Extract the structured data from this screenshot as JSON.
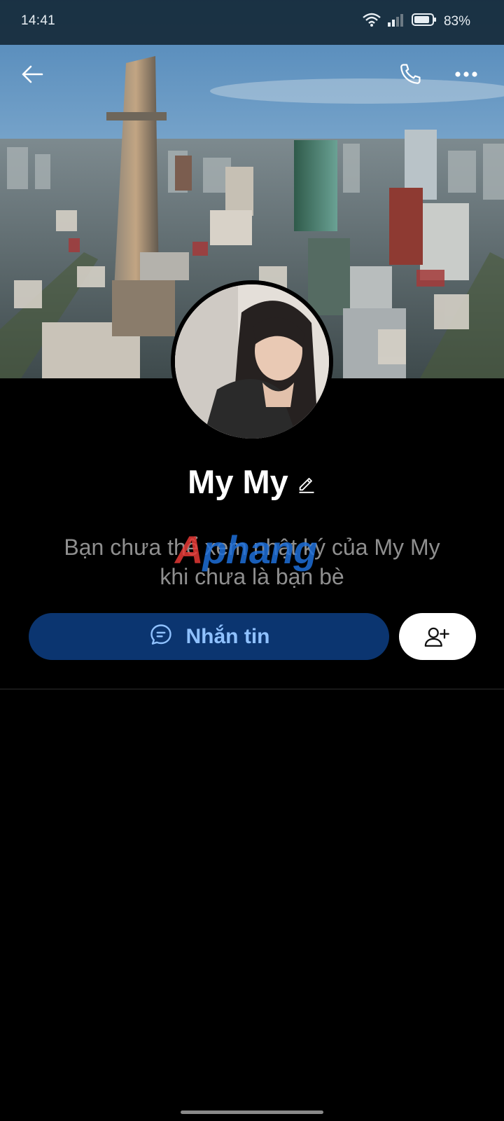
{
  "status_bar": {
    "time": "14:41",
    "battery": "83%"
  },
  "header": {
    "back_icon": "arrow-left-icon",
    "call_icon": "phone-icon",
    "more_icon": "more-dots-icon"
  },
  "profile": {
    "name": "My My",
    "edit_icon": "pencil-icon",
    "info_line1": "Bạn chưa thể xem nhật ký của My My",
    "info_line2": "khi chưa là bạn bè",
    "watermark_a": "A",
    "watermark_rest": "phang"
  },
  "actions": {
    "message_label": "Nhắn tin",
    "message_icon": "chat-bubble-icon",
    "add_friend_icon": "add-friend-icon"
  },
  "colors": {
    "message_button_bg": "#0b3570",
    "message_button_text": "#8fc1ff",
    "background": "#000000"
  }
}
